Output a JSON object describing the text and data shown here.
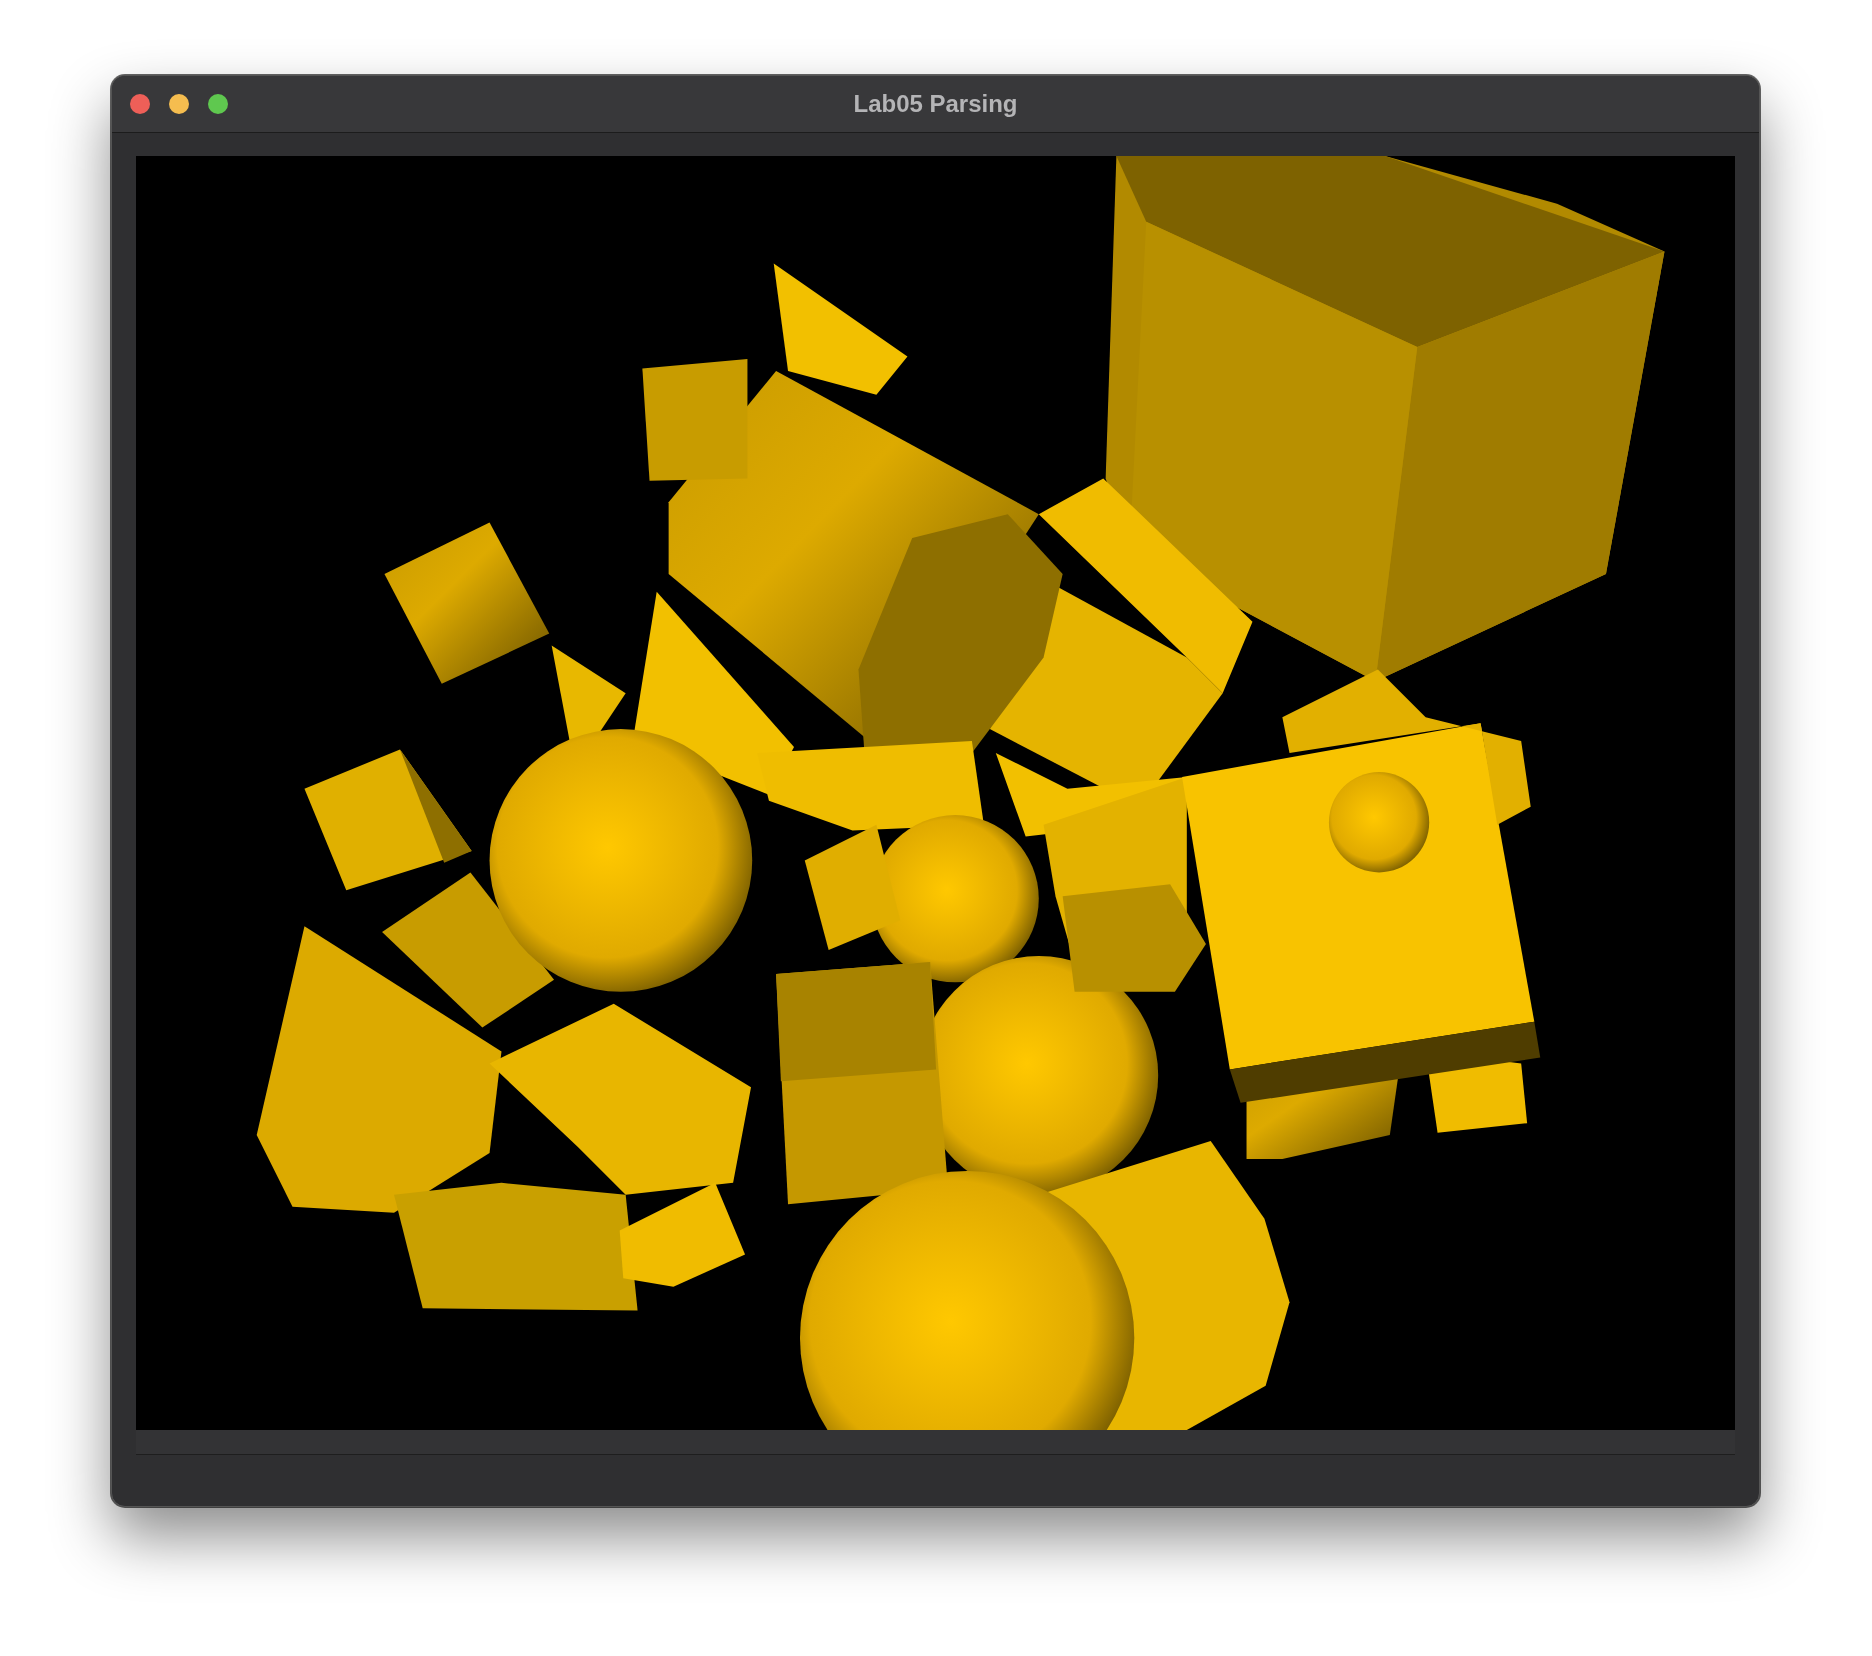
{
  "window": {
    "title": "Lab05 Parsing"
  }
}
